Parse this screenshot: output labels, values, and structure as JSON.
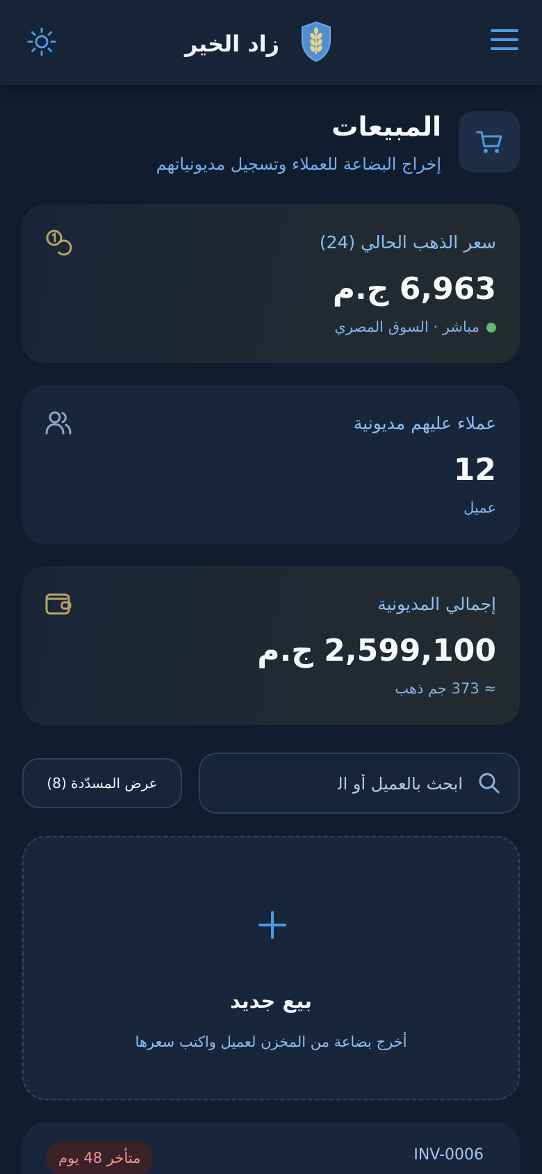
{
  "header": {
    "app_title": "زاد الخير",
    "menu_icon": "hamburger-menu-icon",
    "logo_icon": "shield-wheat-icon",
    "theme_icon": "sun-icon"
  },
  "page": {
    "title": "المبيعات",
    "subtitle": "إخراج البضاعة للعملاء وتسجيل مديونياتهم",
    "icon": "cart-icon"
  },
  "cards": {
    "gold_price": {
      "label": "سعر الذهب الحالي (24)",
      "value": "6,963 ج.م",
      "sub": "مباشر · السوق المصري",
      "icon": "coins-icon",
      "status_color": "#5fb87a"
    },
    "debtors": {
      "label": "عملاء عليهم مديونية",
      "value": "12",
      "sub": "عميل",
      "icon": "users-icon"
    },
    "total_debt": {
      "label": "إجمالي المديونية",
      "value": "2,599,100 ج.م",
      "sub": "≈ 373 جم ذهب",
      "icon": "wallet-icon"
    }
  },
  "search": {
    "placeholder": "ابحث بالعميل أو الكود أو الصنف",
    "icon": "search-icon"
  },
  "filter": {
    "label": "عرض المسدّدة (8)"
  },
  "new_sale": {
    "title": "بيع جديد",
    "description": "أخرج بضاعة من المخزن لعميل واكتب سعرها",
    "icon": "plus-icon"
  },
  "invoices": [
    {
      "id": "INV-0006",
      "status": "متأخر 48 يوم"
    }
  ],
  "colors": {
    "background": "#111d2e",
    "accent": "#4e9be3",
    "gold": "#b8a46a",
    "late": "#f29494"
  }
}
